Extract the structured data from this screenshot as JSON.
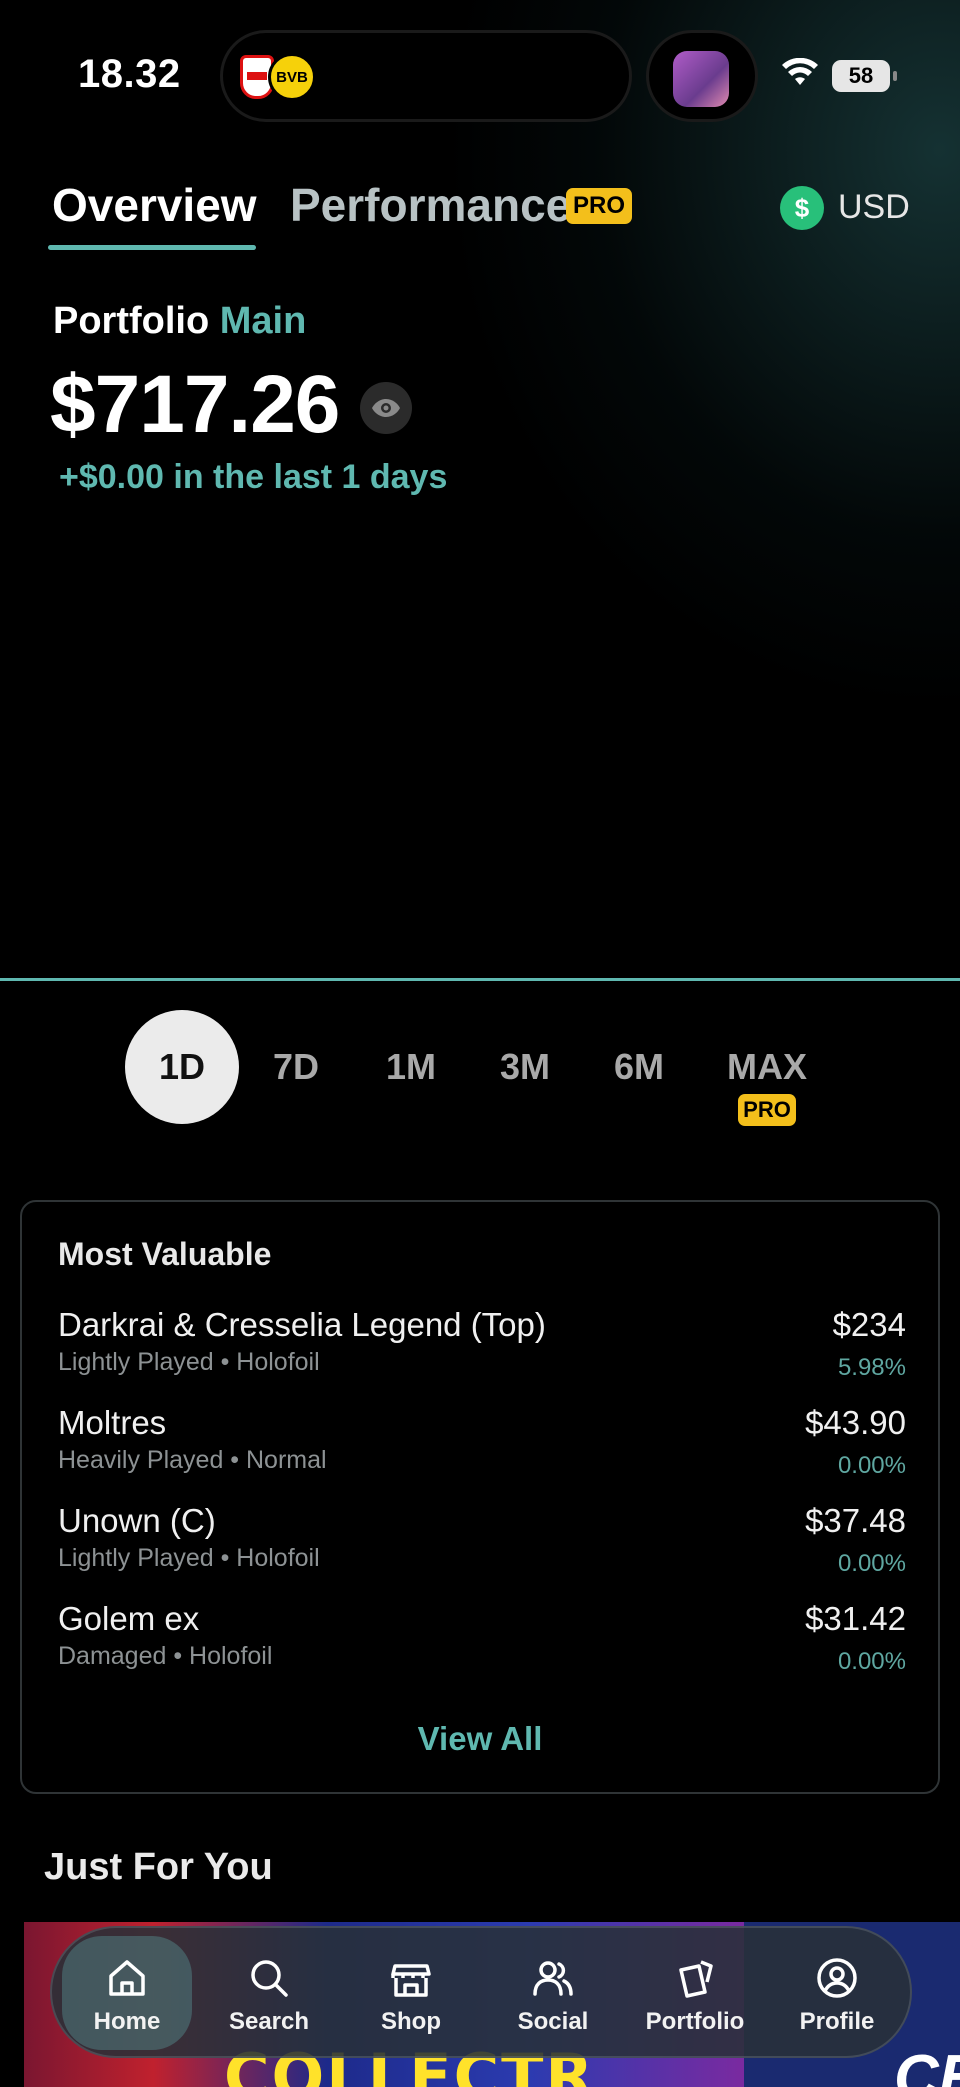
{
  "status_bar": {
    "time": "18.32",
    "bvb_badge": "BVB",
    "battery": "58"
  },
  "header": {
    "tab_overview": "Overview",
    "tab_performance": "Performance",
    "pro_label": "PRO",
    "currency_symbol": "$",
    "currency": "USD"
  },
  "portfolio": {
    "label": "Portfolio",
    "name": "Main",
    "value": "$717.26",
    "change": "+$0.00 in the last 1 days"
  },
  "ranges": {
    "items": [
      "1D",
      "7D",
      "1M",
      "3M",
      "6M",
      "MAX"
    ],
    "active": "1D",
    "max_pro_label": "PRO"
  },
  "most_valuable": {
    "title": "Most Valuable",
    "items": [
      {
        "name": "Darkrai & Cresselia Legend (Top)",
        "sub": "Lightly Played • Holofoil",
        "price": "$234",
        "change": "5.98%"
      },
      {
        "name": "Moltres",
        "sub": "Heavily Played • Normal",
        "price": "$43.90",
        "change": "0.00%"
      },
      {
        "name": "Unown (C)",
        "sub": "Lightly Played • Holofoil",
        "price": "$37.48",
        "change": "0.00%"
      },
      {
        "name": "Golem ex",
        "sub": "Damaged • Holofoil",
        "price": "$31.42",
        "change": "0.00%"
      }
    ],
    "view_all": "View All"
  },
  "just_for_you": {
    "title": "Just For You",
    "banner_text": "COLLECTR",
    "banner2_text": "CE"
  },
  "nav": {
    "items": [
      {
        "label": "Home",
        "icon": "home-icon"
      },
      {
        "label": "Search",
        "icon": "search-icon"
      },
      {
        "label": "Shop",
        "icon": "shop-icon"
      },
      {
        "label": "Social",
        "icon": "social-icon"
      },
      {
        "label": "Portfolio",
        "icon": "portfolio-icon"
      },
      {
        "label": "Profile",
        "icon": "profile-icon"
      }
    ],
    "active": "Home"
  },
  "colors": {
    "accent": "#5fb8b0",
    "pro_badge": "#f3bf1b",
    "currency_icon": "#28c07a",
    "background": "#000000"
  }
}
